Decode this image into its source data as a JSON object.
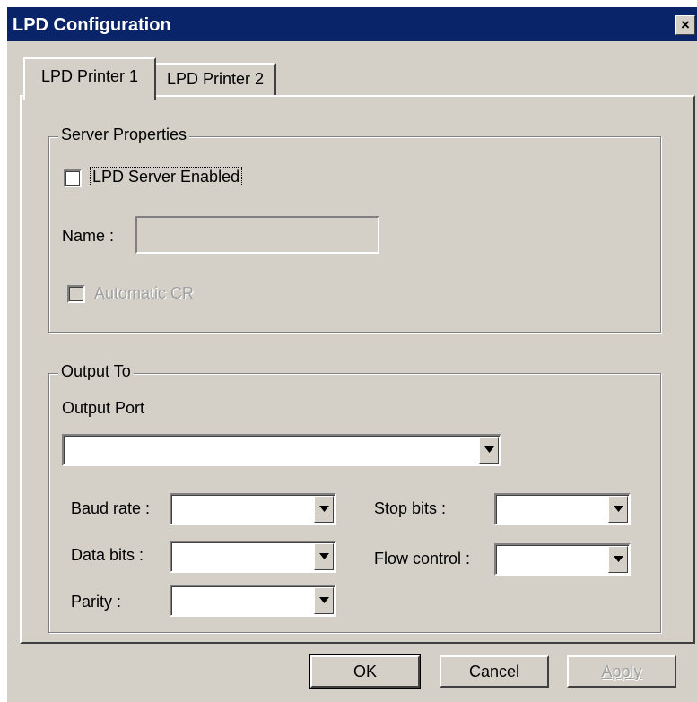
{
  "window": {
    "title": "LPD Configuration"
  },
  "titlebar": {
    "close_glyph": "×"
  },
  "tabs": [
    {
      "label": "LPD Printer 1",
      "active": true
    },
    {
      "label": "LPD Printer 2",
      "active": false
    }
  ],
  "server_properties": {
    "legend": "Server Properties",
    "lpd_server_enabled": {
      "label": "LPD Server Enabled",
      "checked": false
    },
    "name": {
      "label": "Name :",
      "value": ""
    },
    "automatic_cr": {
      "label": "Automatic CR",
      "checked": false,
      "disabled": true
    }
  },
  "output_to": {
    "legend": "Output To",
    "output_port": {
      "label": "Output Port",
      "value": ""
    },
    "baud_rate": {
      "label": "Baud rate :",
      "value": ""
    },
    "data_bits": {
      "label": "Data bits :",
      "value": ""
    },
    "parity": {
      "label": "Parity :",
      "value": ""
    },
    "stop_bits": {
      "label": "Stop bits :",
      "value": ""
    },
    "flow_control": {
      "label": "Flow control :",
      "value": ""
    }
  },
  "buttons": {
    "ok": "OK",
    "cancel": "Cancel",
    "apply": "Apply"
  },
  "icons": {
    "close": "close-icon",
    "dropdown": "chevron-down-icon"
  }
}
